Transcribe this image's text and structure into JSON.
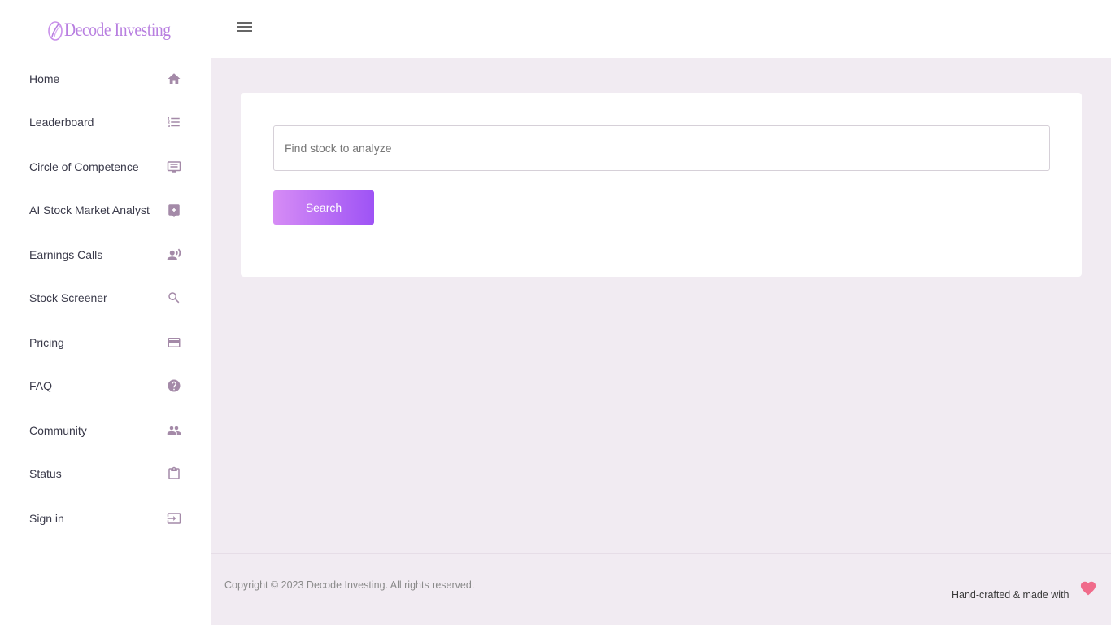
{
  "brand": {
    "name": "Decode Investing"
  },
  "sidebar": {
    "items": [
      {
        "label": "Home",
        "icon": "home-icon"
      },
      {
        "label": "Leaderboard",
        "icon": "list-numbered-icon"
      },
      {
        "label": "Circle of Competence",
        "icon": "message-box-icon"
      },
      {
        "label": "AI Stock Market Analyst",
        "icon": "chat-plus-icon"
      },
      {
        "label": "Earnings Calls",
        "icon": "voice-person-icon"
      },
      {
        "label": "Stock Screener",
        "icon": "search-icon"
      },
      {
        "label": "Pricing",
        "icon": "credit-card-icon"
      },
      {
        "label": "FAQ",
        "icon": "help-circle-icon"
      },
      {
        "label": "Community",
        "icon": "people-icon"
      },
      {
        "label": "Status",
        "icon": "clipboard-icon"
      },
      {
        "label": "Sign in",
        "icon": "login-icon"
      }
    ]
  },
  "search": {
    "placeholder": "Find stock to analyze",
    "value": "",
    "button_label": "Search"
  },
  "footer": {
    "copyright": "Copyright © 2023 Decode Investing. All rights reserved.",
    "made_with": "Hand-crafted & made with"
  },
  "colors": {
    "brand_purple": "#b87fe0",
    "button_gradient_start": "#d68cf5",
    "button_gradient_end": "#9e53f5",
    "main_background": "#f1ebf2",
    "icon_color": "#a48aa8",
    "heart": "#f06b8b"
  }
}
